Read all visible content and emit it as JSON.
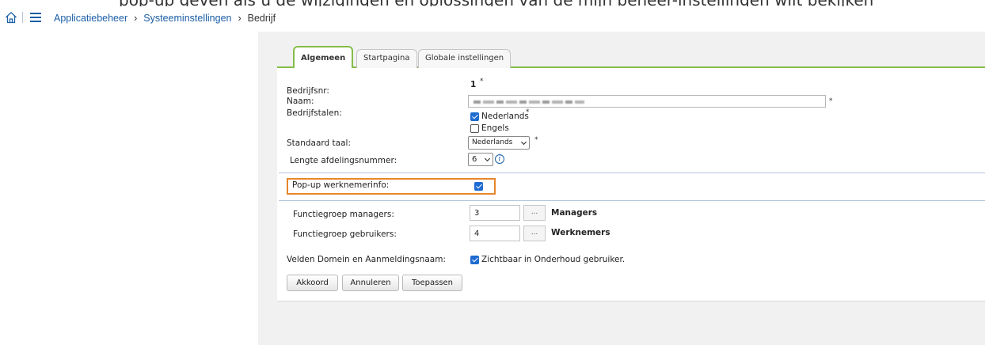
{
  "header_strip": {
    "text": "pop-up geven als u de wijzigingen en oplossingen van de mijn beheer-instellingen wilt bekijken"
  },
  "breadcrumb": {
    "items": [
      "Applicatiebeheer",
      "Systeeminstellingen"
    ],
    "separator": "›",
    "current": "Bedrijf"
  },
  "tabs": [
    {
      "label": "Algemeen",
      "active": true
    },
    {
      "label": "Startpagina",
      "active": false
    },
    {
      "label": "Globale instellingen",
      "active": false
    }
  ],
  "form": {
    "company_nr": {
      "label": "Bedrijfsnr:",
      "value": "1",
      "required_mark": "*"
    },
    "name": {
      "label": "Naam:",
      "value_redacted": true,
      "required_mark": "*"
    },
    "languages": {
      "label": "Bedrijfstalen:",
      "required_mark": "*",
      "options": [
        {
          "label": "Nederlands",
          "checked": true
        },
        {
          "label": "Engels",
          "checked": false
        }
      ]
    },
    "default_language": {
      "label": "Standaard taal:",
      "selected": "Nederlands",
      "required_mark": "*"
    },
    "dept_number_length": {
      "label": "Lengte afdelingsnummer:",
      "selected": "6",
      "info_icon": "info-icon"
    },
    "popup_employee_info": {
      "label": "Pop-up werknemerinfo:",
      "checked": true
    },
    "function_group_managers": {
      "label": "Functiegroep managers:",
      "value": "3",
      "button": "...",
      "name": "Managers"
    },
    "function_group_users": {
      "label": "Functiegroep gebruikers:",
      "value": "4",
      "button": "...",
      "name": "Werknemers"
    },
    "domain_fields": {
      "label": "Velden Domein en Aanmeldingsnaam:",
      "checkbox_label": "Zichtbaar in Onderhoud gebruiker.",
      "checked": true
    }
  },
  "buttons": {
    "ok": "Akkoord",
    "cancel": "Annuleren",
    "apply": "Toepassen"
  },
  "colors": {
    "accent_green": "#84bd48",
    "link_blue": "#1b5ea6",
    "highlight_orange": "#e8862a",
    "checkbox_blue": "#1e6bd1"
  },
  "icons": {
    "home": "home-icon",
    "menu": "hamburger-menu-icon",
    "info": "info-icon"
  }
}
